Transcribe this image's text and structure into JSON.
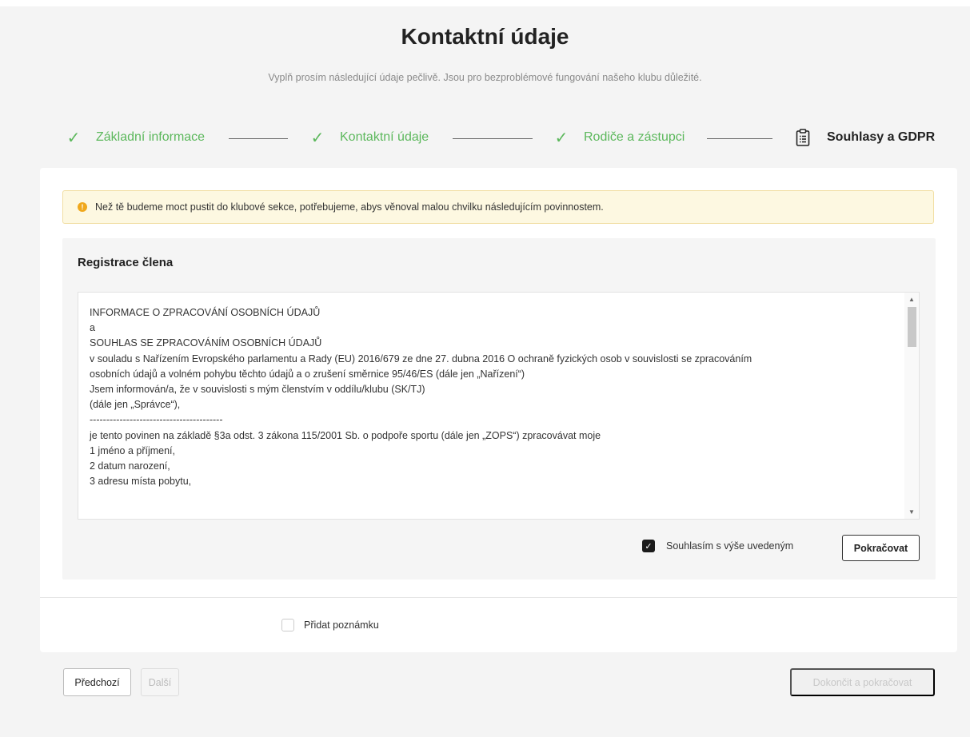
{
  "page": {
    "title": "Kontaktní údaje",
    "subtitle": "Vyplň prosím následující údaje pečlivě. Jsou pro bezproblémové fungování našeho klubu důležité."
  },
  "stepper": {
    "steps": [
      {
        "label": "Základní informace",
        "state": "done",
        "icon": "check-icon"
      },
      {
        "label": "Kontaktní údaje",
        "state": "done",
        "icon": "check-icon"
      },
      {
        "label": "Rodiče a zástupci",
        "state": "done",
        "icon": "check-icon"
      },
      {
        "label": "Souhlasy a GDPR",
        "state": "active",
        "icon": "clipboard-list-icon"
      }
    ]
  },
  "alert": {
    "icon": "warning-dot-icon",
    "text": "Než tě budeme moct pustit do klubové sekce, potřebujeme, abys věnoval malou chvilku následujícím povinnostem."
  },
  "consent": {
    "section_title": "Registrace člena",
    "lines": [
      "INFORMACE O ZPRACOVÁNÍ OSOBNÍCH ÚDAJŮ",
      "a",
      "SOUHLAS SE ZPRACOVÁNÍM OSOBNÍCH ÚDAJŮ",
      "v souladu s Nařízením Evropského parlamentu a Rady (EU) 2016/679 ze dne 27. dubna 2016 O ochraně fyzických osob v souvislosti se zpracováním",
      "osobních údajů a volném pohybu těchto údajů a o zrušení směrnice 95/46/ES (dále jen „Nařízení“)",
      "Jsem informován/a, že v souvislosti s mým členstvím v oddílu/klubu (SK/TJ)",
      "(dále jen „Správce“),",
      "----------------------------------------",
      "je tento povinen na základě §3a odst. 3 zákona 115/2001 Sb. o podpoře sportu (dále jen „ZOPS“) zpracovávat moje",
      "1 jméno a příjmení,",
      "2 datum narození,",
      "3 adresu místa pobytu,"
    ],
    "agree_label": "Souhlasím s výše uvedeným",
    "agree_checked": true,
    "continue_label": "Pokračovat"
  },
  "note": {
    "label": "Přidat poznámku",
    "checked": false
  },
  "footer": {
    "prev_label": "Předchozí",
    "next_label": "Další",
    "finish_label": "Dokončit a pokračovat"
  },
  "colors": {
    "success": "#5cb85c",
    "alert_bg": "#fdf8e1",
    "alert_icon": "#f0a81c"
  }
}
